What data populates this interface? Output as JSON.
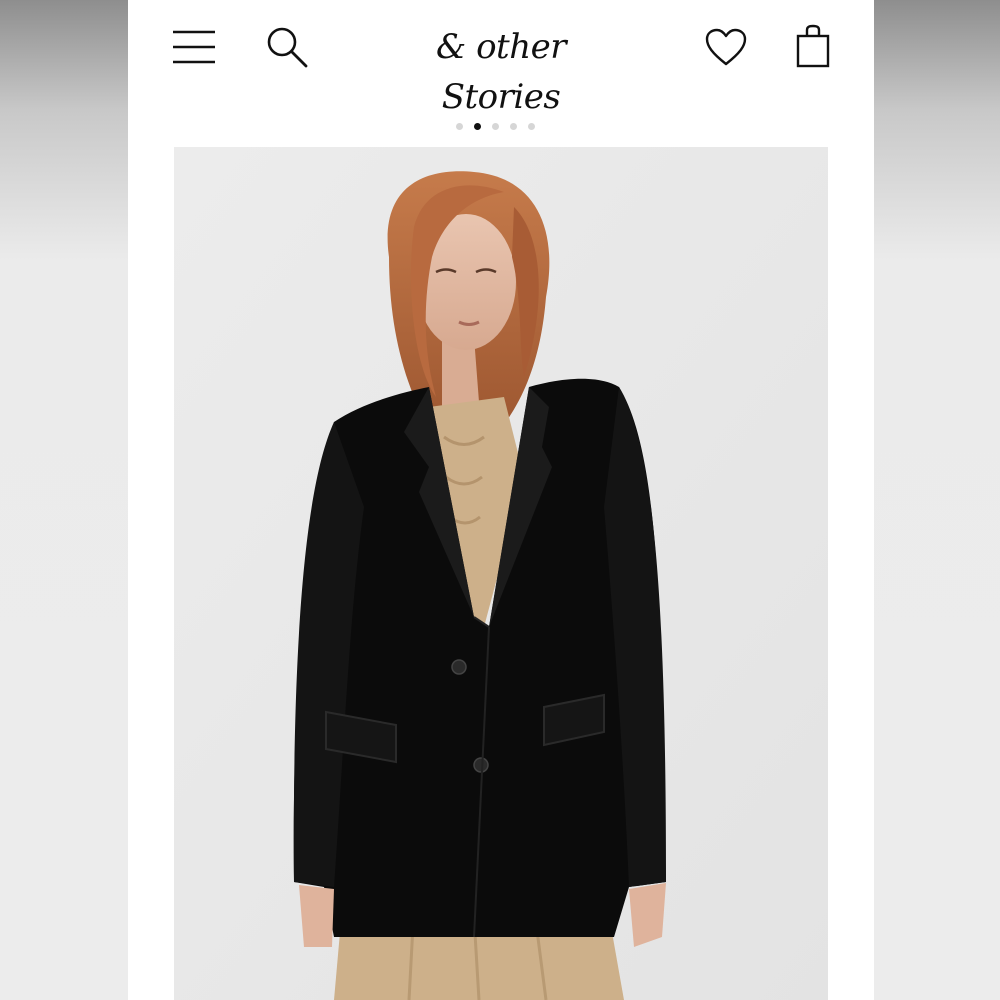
{
  "header": {
    "logo_text": "& other Stories",
    "menu_icon": "hamburger-menu-icon",
    "search_icon": "search-icon",
    "wishlist_icon": "heart-icon",
    "bag_icon": "shopping-bag-icon"
  },
  "carousel": {
    "total_images": 5,
    "active_index": 1
  },
  "product_image": {
    "subject": "model-wearing-black-blazer",
    "colors": {
      "blazer": "#0b0b0b",
      "top": "#cdb08a",
      "background": "#ebebeb",
      "hair": "#b86a3f"
    }
  }
}
